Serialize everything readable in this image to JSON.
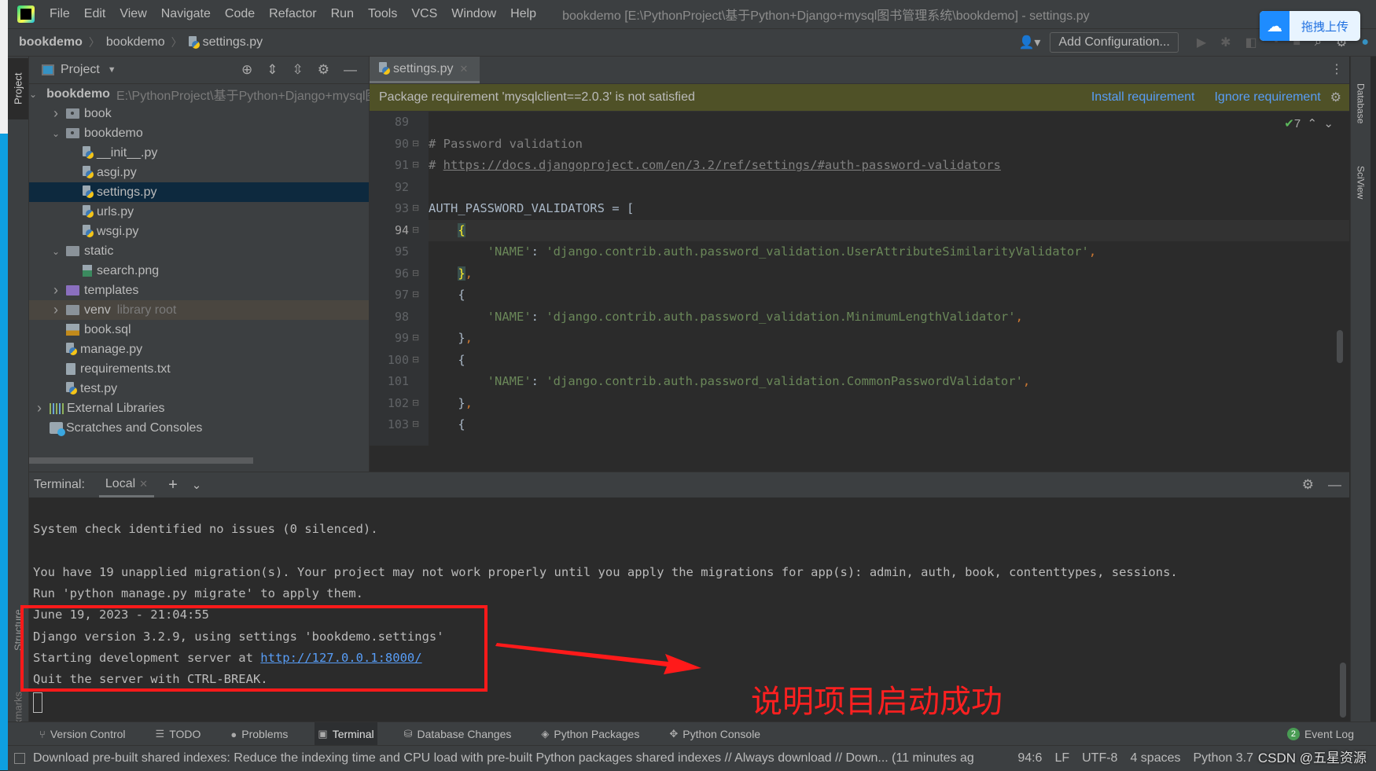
{
  "menubar": {
    "items": [
      "File",
      "Edit",
      "View",
      "Navigate",
      "Code",
      "Refactor",
      "Run",
      "Tools",
      "VCS",
      "Window",
      "Help"
    ],
    "window_title": "bookdemo [E:\\PythonProject\\基于Python+Django+mysql图书管理系统\\bookdemo] - settings.py"
  },
  "navbar": {
    "breadcrumbs": [
      "bookdemo",
      "bookdemo",
      "settings.py"
    ],
    "add_configuration": "Add Configuration..."
  },
  "upload_widget": {
    "label": "拖拽上传"
  },
  "left_stripe": {
    "project": "Project",
    "structure": "Structure",
    "bookmarks": "Bookmarks"
  },
  "right_stripe": {
    "database": "Database",
    "sciview": "SciView"
  },
  "project_panel": {
    "title": "Project",
    "tree": [
      {
        "label": "bookdemo",
        "hint": "E:\\PythonProject\\基于Python+Django+mysql图书管理系统\\bookdemo",
        "type": "folder",
        "expanded": true
      },
      {
        "label": "book",
        "type": "package",
        "expanded": false
      },
      {
        "label": "bookdemo",
        "type": "package",
        "expanded": true
      },
      {
        "label": "__init__.py",
        "type": "python"
      },
      {
        "label": "asgi.py",
        "type": "python"
      },
      {
        "label": "settings.py",
        "type": "python",
        "selected": true
      },
      {
        "label": "urls.py",
        "type": "python"
      },
      {
        "label": "wsgi.py",
        "type": "python"
      },
      {
        "label": "static",
        "type": "folder",
        "expanded": true
      },
      {
        "label": "search.png",
        "type": "image"
      },
      {
        "label": "templates",
        "type": "templates",
        "expanded": false
      },
      {
        "label": "venv",
        "hint": "library root",
        "type": "folder",
        "expanded": false
      },
      {
        "label": "book.sql",
        "type": "sql"
      },
      {
        "label": "manage.py",
        "type": "python"
      },
      {
        "label": "requirements.txt",
        "type": "text"
      },
      {
        "label": "test.py",
        "type": "python"
      },
      {
        "label": "External Libraries",
        "type": "libraries",
        "expanded": false
      },
      {
        "label": "Scratches and Consoles",
        "type": "scratches"
      }
    ]
  },
  "editor": {
    "tab": "settings.py",
    "banner": {
      "message": "Package requirement 'mysqlclient==2.0.3' is not satisfied",
      "install": "Install requirement",
      "ignore": "Ignore requirement"
    },
    "inspection_count": "7",
    "current_line": 94,
    "lines": [
      {
        "n": "89",
        "text": ""
      },
      {
        "n": "90",
        "text": "# Password validation"
      },
      {
        "n": "91",
        "text": "# ",
        "link": "https://docs.djangoproject.com/en/3.2/ref/settings/#auth-password-validators"
      },
      {
        "n": "92",
        "text": ""
      },
      {
        "n": "93",
        "text": "AUTH_PASSWORD_VALIDATORS = ["
      },
      {
        "n": "94",
        "text": "{"
      },
      {
        "n": "95",
        "text": "'NAME': 'django.contrib.auth.password_validation.UserAttributeSimilarityValidator',"
      },
      {
        "n": "96",
        "text": "},"
      },
      {
        "n": "97",
        "text": "{"
      },
      {
        "n": "98",
        "text": "'NAME': 'django.contrib.auth.password_validation.MinimumLengthValidator',"
      },
      {
        "n": "99",
        "text": "},"
      },
      {
        "n": "100",
        "text": "{"
      },
      {
        "n": "101",
        "text": "'NAME': 'django.contrib.auth.password_validation.CommonPasswordValidator',"
      },
      {
        "n": "102",
        "text": "},"
      },
      {
        "n": "103",
        "text": "{"
      }
    ]
  },
  "terminal": {
    "label": "Terminal:",
    "tab": "Local",
    "lines": [
      "System check identified no issues (0 silenced).",
      "",
      "You have 19 unapplied migration(s). Your project may not work properly until you apply the migrations for app(s): admin, auth, book, contenttypes, sessions.",
      "Run 'python manage.py migrate' to apply them.",
      "June 19, 2023 - 21:04:55",
      "Django version 3.2.9, using settings 'bookdemo.settings'",
      "Starting development server at ",
      "Quit the server with CTRL-BREAK."
    ],
    "server_url": "http://127.0.0.1:8000/"
  },
  "annotation": {
    "text": "说明项目启动成功",
    "color": "#ff2020"
  },
  "tool_windows": [
    {
      "label": "Version Control",
      "icon": "branch-icon"
    },
    {
      "label": "TODO",
      "icon": "list-icon"
    },
    {
      "label": "Problems",
      "icon": "warning-icon"
    },
    {
      "label": "Terminal",
      "icon": "terminal-icon",
      "active": true
    },
    {
      "label": "Database Changes",
      "icon": "database-icon"
    },
    {
      "label": "Python Packages",
      "icon": "packages-icon"
    },
    {
      "label": "Python Console",
      "icon": "python-icon"
    }
  ],
  "event_log": {
    "label": "Event Log",
    "count": "2"
  },
  "status_bar": {
    "message": "Download pre-built shared indexes: Reduce the indexing time and CPU load with pre-built Python packages shared indexes // Always download // Down... (11 minutes ag",
    "position": "94:6",
    "line_sep": "LF",
    "encoding": "UTF-8",
    "indent": "4 spaces",
    "interpreter": "Python 3.7",
    "watermark": "CSDN @五星资源"
  }
}
